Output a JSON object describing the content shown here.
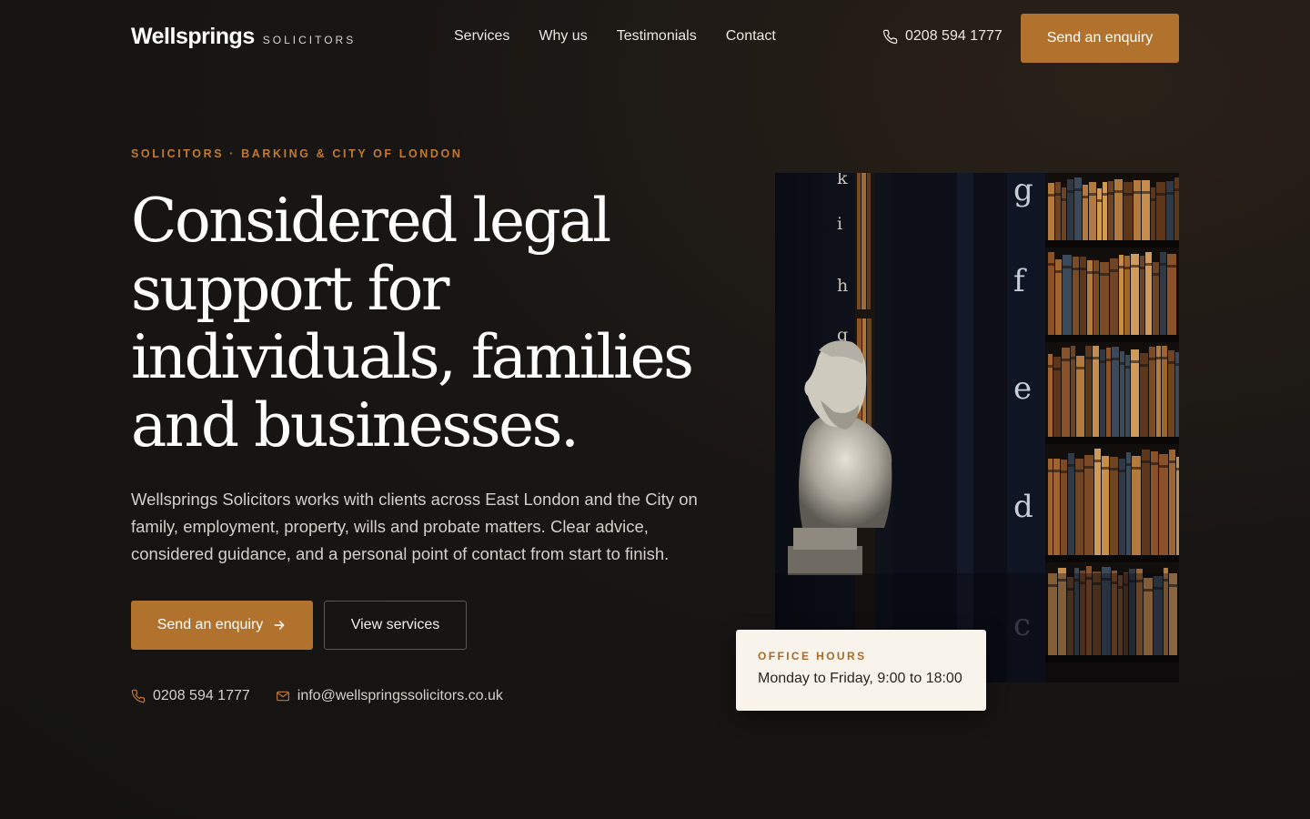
{
  "header": {
    "brand_name": "Wellsprings",
    "brand_sub": "SOLICITORS",
    "nav": [
      {
        "label": "Services"
      },
      {
        "label": "Why us"
      },
      {
        "label": "Testimonials"
      },
      {
        "label": "Contact"
      }
    ],
    "phone": "0208 594 1777",
    "phone_icon": "phone-icon",
    "cta_label": "Send an enquiry"
  },
  "hero": {
    "eyebrow": "SOLICITORS · BARKING & CITY OF LONDON",
    "headline_lines": [
      "Considered legal",
      "support for",
      "individuals, families",
      "and businesses."
    ],
    "lede": "Wellsprings Solicitors works with clients across East London and the City on family, employment, property, wills and probate matters. Clear advice, considered guidance, and a personal point of contact from start to finish.",
    "primary_cta": "Send an enquiry",
    "primary_cta_icon": "arrow-right-icon",
    "secondary_cta": "View services",
    "phone": "0208 594 1777",
    "email": "info@wellspringssolicitors.co.uk",
    "email_icon": "mail-icon"
  },
  "image": {
    "shelf_letters_left": [
      "k",
      "i",
      "h",
      "g"
    ],
    "shelf_letters_right": [
      "g",
      "f",
      "e",
      "d",
      "c"
    ]
  },
  "office_hours": {
    "label": "OFFICE HOURS",
    "text": "Monday to Friday, 9:00 to 18:00"
  },
  "colors": {
    "accent": "#b0722c",
    "eyebrow": "#c07a34",
    "background": "#161413",
    "card": "#f8f4ec"
  }
}
